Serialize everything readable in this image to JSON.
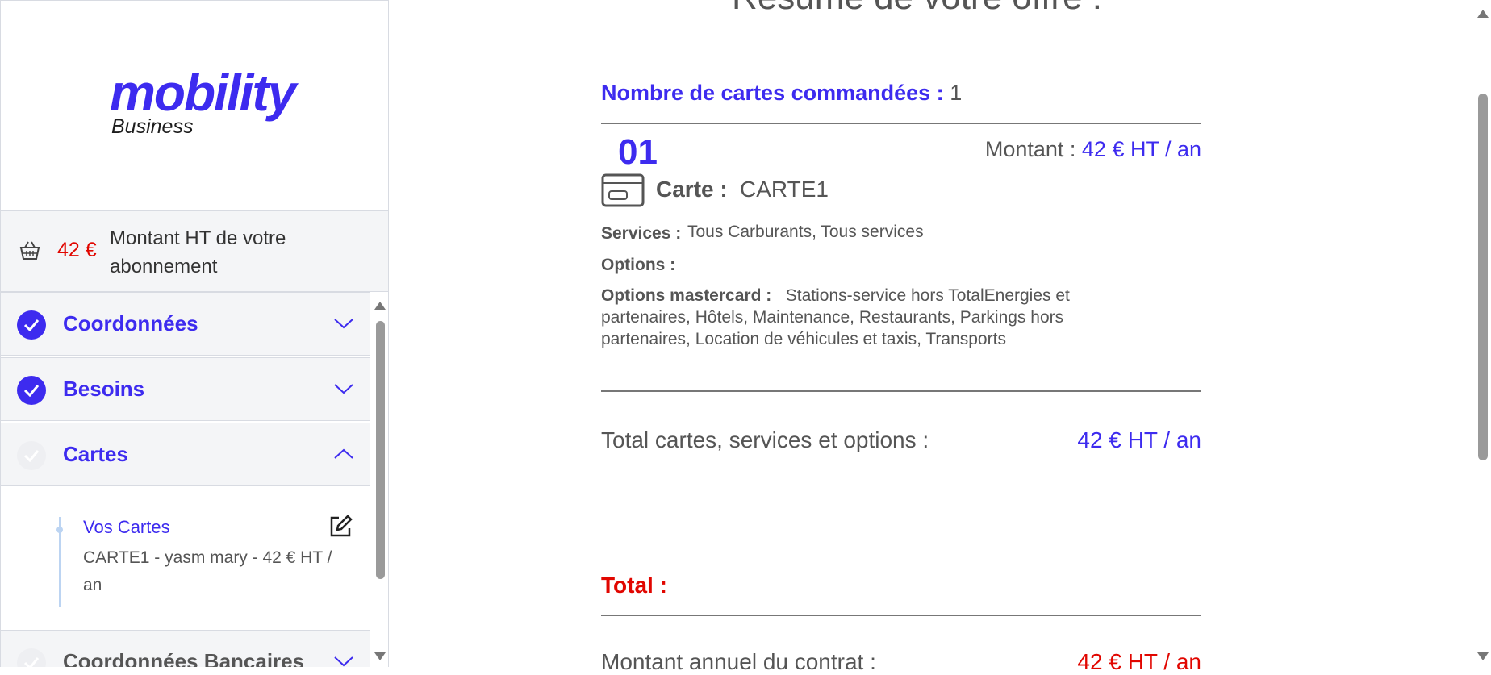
{
  "brand": {
    "logo_word": "mobility",
    "logo_sub": "Business"
  },
  "summary": {
    "amount": "42 €",
    "label": "Montant HT de votre abonnement"
  },
  "steps": [
    {
      "label": "Coordonnées",
      "status": "done",
      "expanded": false
    },
    {
      "label": "Besoins",
      "status": "done",
      "expanded": false
    },
    {
      "label": "Cartes",
      "status": "pending",
      "expanded": true
    },
    {
      "label": "Coordonnées Bancaires",
      "status": "pending",
      "expanded": false
    }
  ],
  "cards_panel": {
    "title": "Vos Cartes",
    "desc": "CARTE1 - yasm mary - 42 € HT / an"
  },
  "main": {
    "title": "Résumé de votre offre :",
    "count_label": "Nombre de cartes commandées :",
    "count_value": "1",
    "card": {
      "number": "01",
      "montant_label": "Montant :",
      "montant_value": "42 € HT / an",
      "carte_label": "Carte :",
      "carte_value": "CARTE1",
      "services_label": "Services :",
      "services_value": "Tous Carburants, Tous services",
      "options_label": "Options :",
      "mastercard_label": "Options mastercard :",
      "mastercard_value": "Stations-service hors TotalEnergies et partenaires, Hôtels, Maintenance, Restaurants, Parkings hors partenaires, Location de véhicules et taxis, Transports"
    },
    "total_cards_label": "Total cartes, services et options :",
    "total_cards_value": "42 € HT / an",
    "total_label": "Total :",
    "annual_label": "Montant annuel du contrat :",
    "annual_value": "42 € HT / an"
  },
  "colors": {
    "accent": "#3d2bef",
    "alert": "#e10600",
    "panel": "#f4f5f7"
  }
}
